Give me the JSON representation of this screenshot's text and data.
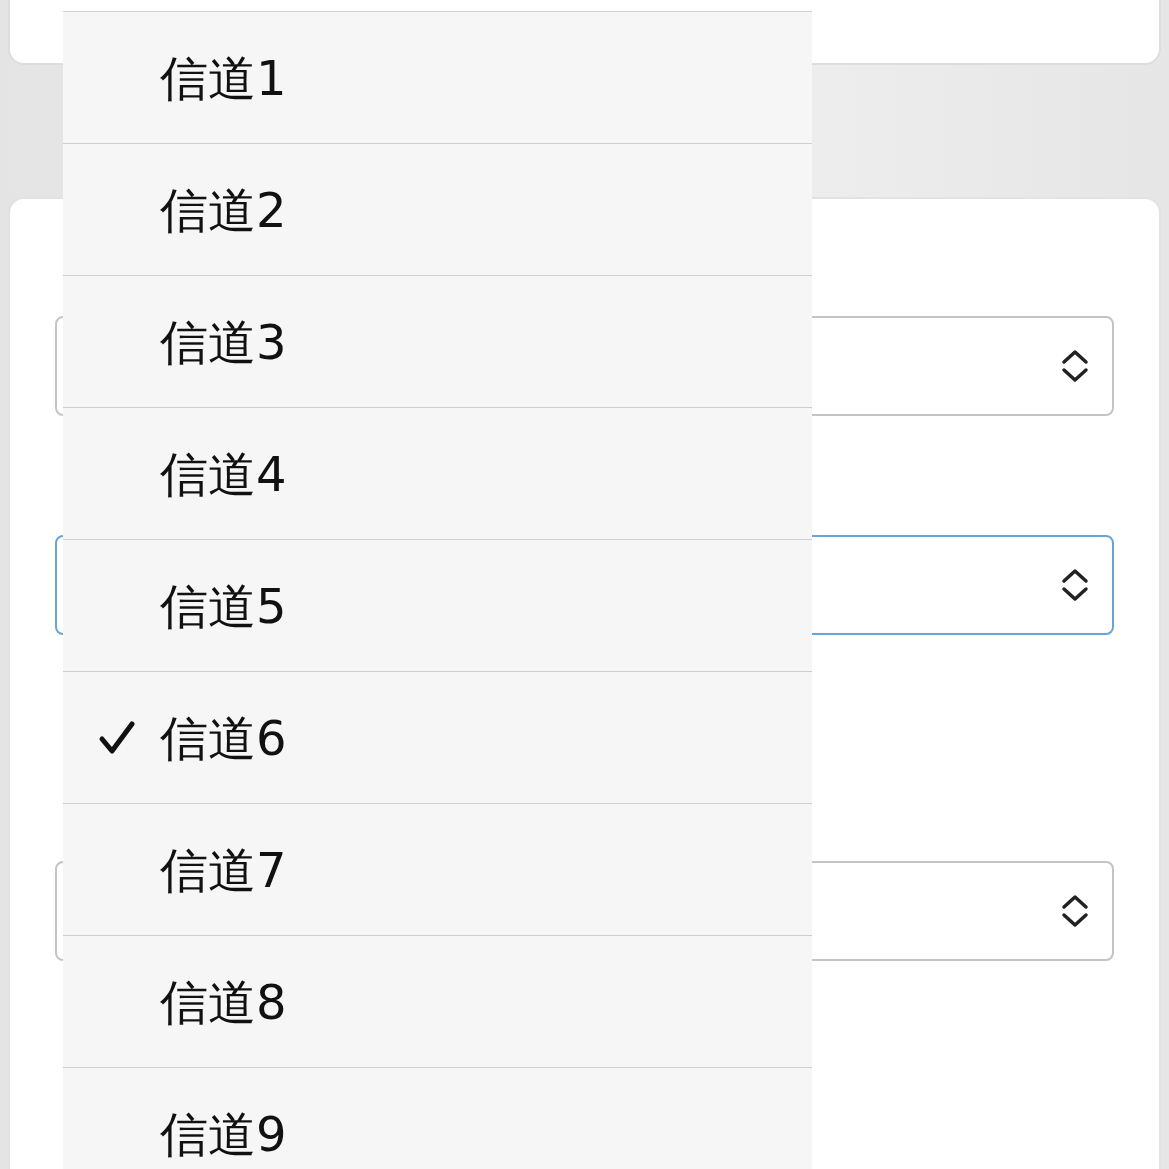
{
  "fields": [
    {
      "focused": false
    },
    {
      "focused": true
    },
    {
      "focused": false
    }
  ],
  "menu": {
    "items": [
      {
        "label": "信道1",
        "selected": false
      },
      {
        "label": "信道2",
        "selected": false
      },
      {
        "label": "信道3",
        "selected": false
      },
      {
        "label": "信道4",
        "selected": false
      },
      {
        "label": "信道5",
        "selected": false
      },
      {
        "label": "信道6",
        "selected": true
      },
      {
        "label": "信道7",
        "selected": false
      },
      {
        "label": "信道8",
        "selected": false
      },
      {
        "label": "信道9",
        "selected": false
      }
    ]
  }
}
